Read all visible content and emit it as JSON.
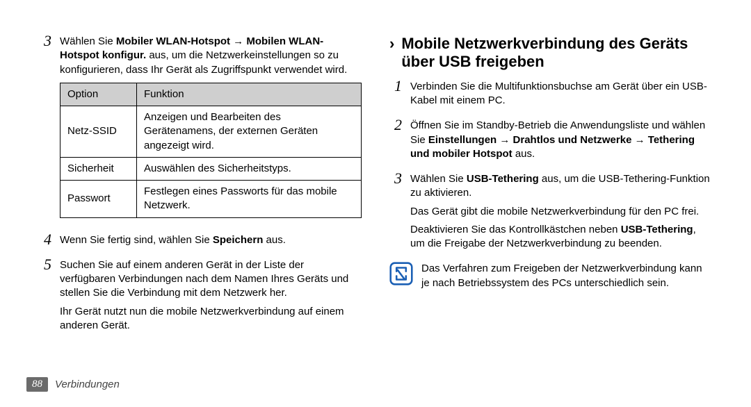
{
  "left": {
    "step3": {
      "num": "3",
      "text_before": "Wählen Sie ",
      "bold1": "Mobiler WLAN-Hotspot",
      "arrow": " → ",
      "bold2": "Mobilen WLAN-Hotspot konfigur.",
      "text_after": " aus, um die Netzwerkeinstellungen so zu konfigurieren, dass Ihr Gerät als Zugriffspunkt verwendet wird."
    },
    "table": {
      "head_option": "Option",
      "head_funktion": "Funktion",
      "rows": [
        {
          "opt": "Netz-SSID",
          "fn": "Anzeigen und Bearbeiten des Gerätenamens, der externen Geräten angezeigt wird."
        },
        {
          "opt": "Sicherheit",
          "fn": "Auswählen des Sicherheitstyps."
        },
        {
          "opt": "Passwort",
          "fn": "Festlegen eines Passworts für das mobile Netzwerk."
        }
      ]
    },
    "step4": {
      "num": "4",
      "text_before": "Wenn Sie fertig sind, wählen Sie ",
      "bold": "Speichern",
      "text_after": " aus."
    },
    "step5": {
      "num": "5",
      "para1": "Suchen Sie auf einem anderen Gerät in der Liste der verfügbaren Verbindungen nach dem Namen Ihres Geräts und stellen Sie die Verbindung mit dem Netzwerk her.",
      "para2": "Ihr Gerät nutzt nun die mobile Netzwerkverbindung auf einem anderen Gerät."
    }
  },
  "right": {
    "heading": "Mobile Netzwerkverbindung des Geräts über USB freigeben",
    "step1": {
      "num": "1",
      "text": "Verbinden Sie die Multifunktionsbuchse am Gerät über ein USB-Kabel mit einem PC."
    },
    "step2": {
      "num": "2",
      "text_before": "Öffnen Sie im Standby-Betrieb die Anwendungsliste und wählen Sie ",
      "bold1": "Einstellungen",
      "arrow1": " → ",
      "bold2": "Drahtlos und Netzwerke",
      "arrow2": " → ",
      "bold3": "Tethering und mobiler Hotspot",
      "text_after": " aus."
    },
    "step3": {
      "num": "3",
      "text_before": "Wählen Sie ",
      "bold": "USB-Tethering",
      "text_after": " aus, um die USB-Tethering-Funktion zu aktivieren.",
      "para2": "Das Gerät gibt die mobile Netzwerkverbindung für den PC frei.",
      "para3_before": "Deaktivieren Sie das Kontrollkästchen neben ",
      "para3_bold": "USB-Tethering",
      "para3_after": ", um die Freigabe der Netzwerkverbindung zu beenden."
    },
    "note": "Das Verfahren zum Freigeben der Netzwerkverbindung kann je nach Betriebssystem des PCs unterschiedlich sein."
  },
  "footer": {
    "page_num": "88",
    "section": "Verbindungen"
  }
}
